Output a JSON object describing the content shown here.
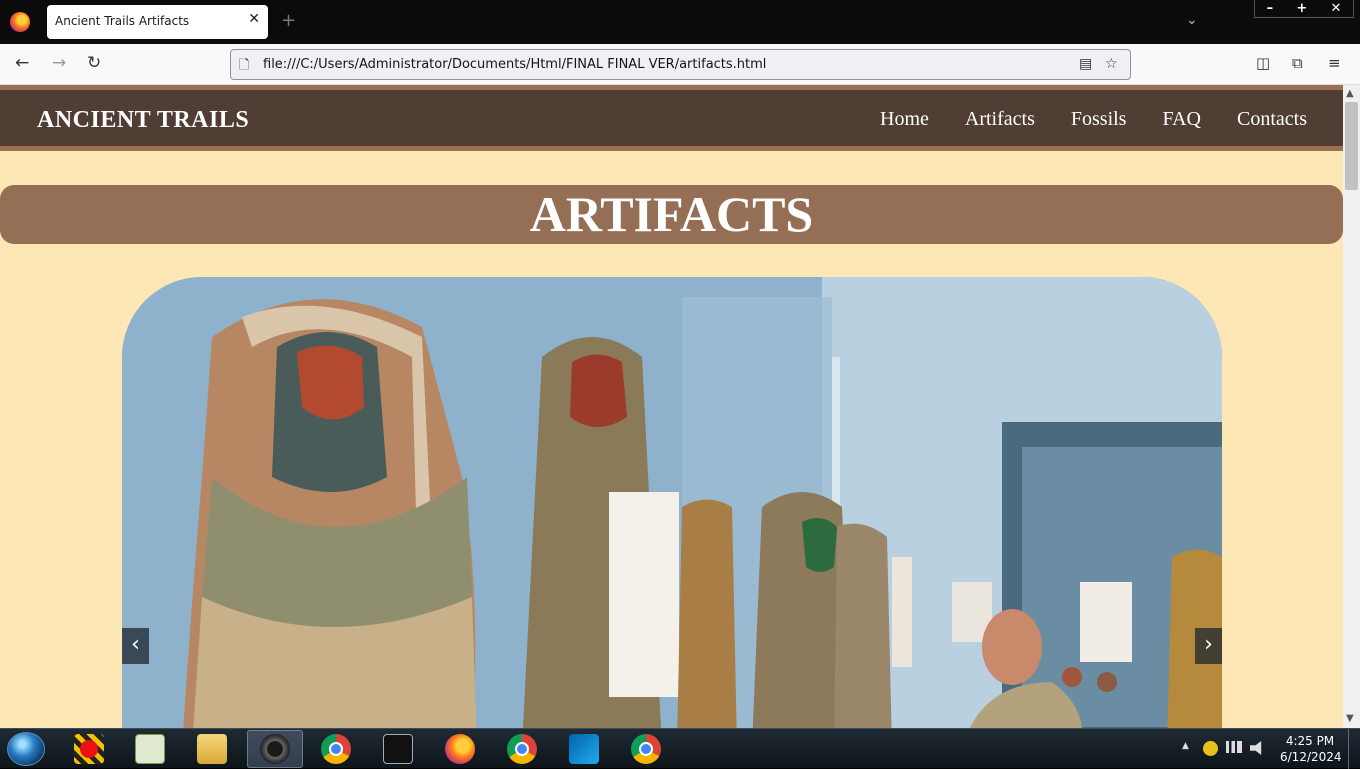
{
  "browser": {
    "tab_title": "Ancient Trails Artifacts",
    "tab_close": "✕",
    "new_tab": "+",
    "tab_list": "⌄",
    "window_controls": {
      "minimize": "–",
      "maximize": "+",
      "close": "✕"
    },
    "back": "←",
    "forward": "→",
    "reload": "↻",
    "url": "file:///C:/Users/Administrator/Documents/Html/FINAL FINAL VER/artifacts.html",
    "page_icon": "🗋",
    "reader_icon": "▤",
    "bookmark_icon": "☆",
    "pocket_icon": "◫",
    "extensions_icon": "⧉",
    "menu_icon": "≡"
  },
  "site": {
    "brand": "ANCIENT TRAILS",
    "nav": [
      "Home",
      "Artifacts",
      "Fossils",
      "FAQ",
      "Contacts"
    ],
    "page_title": "ARTIFACTS"
  },
  "slider": {
    "prev": "‹",
    "next": "›",
    "image_description_colors": {
      "sky": "#a4c0d6",
      "sarcophagus": "#c9a07a"
    }
  },
  "scrollbar": {
    "up": "▲",
    "down": "▼"
  },
  "taskbar": {
    "clock_time": "4:25 PM",
    "clock_date": "6/12/2024",
    "tray_expand": "▲"
  }
}
